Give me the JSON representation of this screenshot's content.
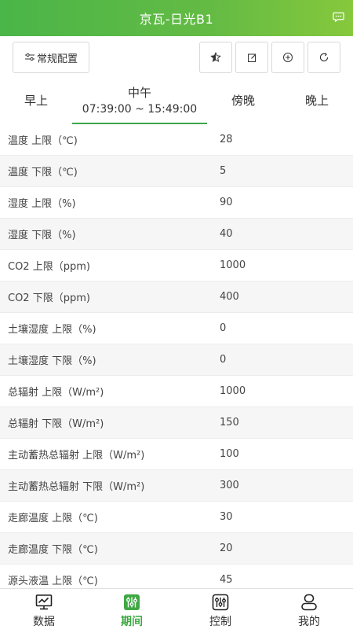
{
  "header": {
    "title": "京瓦-日光B1",
    "chat_icon": "chat-bubble-icon"
  },
  "toolbar": {
    "config_label": "常规配置",
    "config_icon": "sliders-icon",
    "actions": [
      "star-icon",
      "edit-icon",
      "add-circle-icon",
      "refresh-icon"
    ]
  },
  "tabs": [
    {
      "label": "早上",
      "time": ""
    },
    {
      "label": "中午",
      "time": "07:39:00 ~ 15:49:00"
    },
    {
      "label": "傍晚",
      "time": ""
    },
    {
      "label": "晚上",
      "time": ""
    }
  ],
  "active_tab": 1,
  "rows": [
    {
      "label": "温度 上限（℃)",
      "value": "28"
    },
    {
      "label": "温度 下限（℃)",
      "value": "5"
    },
    {
      "label": "湿度 上限（%)",
      "value": "90"
    },
    {
      "label": "湿度 下限（%)",
      "value": "40"
    },
    {
      "label": "CO2 上限（ppm)",
      "value": "1000"
    },
    {
      "label": "CO2 下限（ppm)",
      "value": "400"
    },
    {
      "label": "土壤湿度 上限（%)",
      "value": "0"
    },
    {
      "label": "土壤湿度 下限（%)",
      "value": "0"
    },
    {
      "label": "总辐射 上限（W/m²)",
      "value": "1000"
    },
    {
      "label": "总辐射 下限（W/m²)",
      "value": "150"
    },
    {
      "label": "主动蓄热总辐射 上限（W/m²)",
      "value": "100"
    },
    {
      "label": "主动蓄热总辐射 下限（W/m²)",
      "value": "300"
    },
    {
      "label": "走廊温度 上限（℃)",
      "value": "30"
    },
    {
      "label": "走廊温度 下限（℃)",
      "value": "20"
    },
    {
      "label": "源头液温 上限（℃)",
      "value": "45"
    }
  ],
  "bottom_nav": [
    {
      "label": "数据",
      "icon": "monitor-chart-icon"
    },
    {
      "label": "期间",
      "icon": "sliders-period-icon"
    },
    {
      "label": "控制",
      "icon": "control-panel-icon"
    },
    {
      "label": "我的",
      "icon": "user-icon"
    }
  ],
  "active_nav": 1,
  "colors": {
    "accent": "#3fa843",
    "header_start": "#4ab548",
    "header_end": "#86c83c"
  }
}
